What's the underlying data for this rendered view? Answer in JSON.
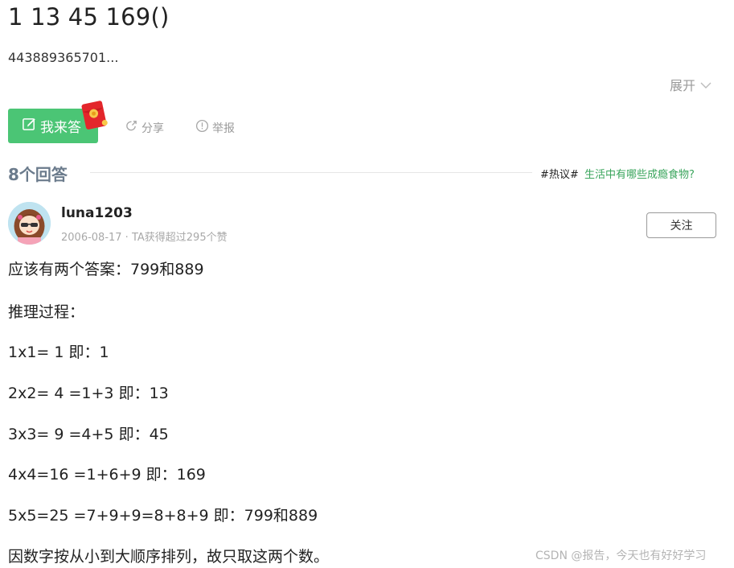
{
  "question": {
    "title": "1 13 45 169()",
    "description": "443889365701...",
    "expand_label": "展开"
  },
  "actions": {
    "answer_label": "我来答",
    "share_label": "分享",
    "report_label": "举报"
  },
  "answers": {
    "count_label": "8个回答",
    "hot_tag": "#热议#",
    "hot_topic": "生活中有哪些成瘾食物?"
  },
  "answer": {
    "username": "luna1203",
    "meta": "2006-08-17 · TA获得超过295个赞",
    "follow_label": "关注",
    "lines": [
      "应该有两个答案：799和889",
      "推理过程：",
      "1x1= 1 即：1",
      "2x2= 4 =1+3 即：13",
      "3x3= 9 =4+5 即：45",
      "4x4=16 =1+6+9 即：169",
      "5x5=25 =7+9+9=8+8+9 即：799和889",
      "因数字按从小到大顺序排列，故只取这两个数。"
    ]
  },
  "watermark": "CSDN @报告，今天也有好好学习",
  "colors": {
    "accent_green": "#4bc575",
    "link_green": "#3aa55c",
    "muted": "#9a9a9a"
  }
}
